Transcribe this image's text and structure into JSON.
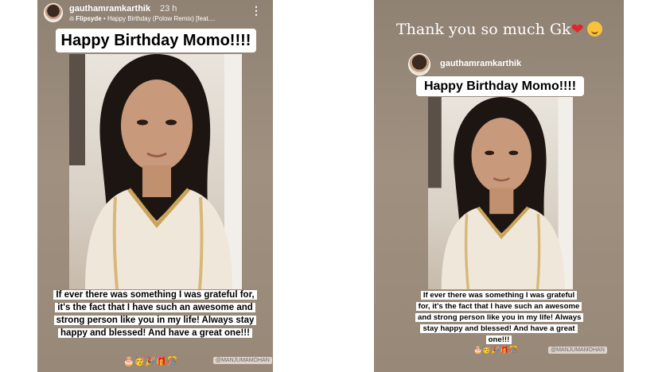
{
  "left_story": {
    "username": "gauthamramkarthik",
    "time_ago": "23 h",
    "music_artist": "Flipsyde",
    "music_separator": " • ",
    "music_title": "Happy Birthday (Polow Remix) [feat....",
    "more_icon": "⋮",
    "title": "Happy Birthday Momo!!!!",
    "message": "If ever there was something I was grateful for, it's the fact that I have such an awesome and strong person like you in my life! Always stay happy and blessed! And have a great one!!!",
    "emojis": "🎂🥳🎉🎁🎊",
    "mention_tag": "@MANJUMAMOHAN"
  },
  "right_story": {
    "caption_text": "Thank you so much Gk",
    "caption_heart": "❤",
    "shared_username": "gauthamramkarthik",
    "title": "Happy Birthday Momo!!!!",
    "message": "If ever there was something I was grateful for, it's the fact that I have such an awesome and strong person like you in my life! Always stay happy and blessed! And have a great one!!!",
    "emojis": "🎂🥳🎉🎁🎊",
    "mention_tag": "@MANJUMAMOHAN"
  },
  "colors": {
    "story_background": "#978877",
    "text_white": "#ffffff",
    "heart_red": "#e3242b",
    "hug_yellow": "#f8c33a"
  },
  "icons": [
    "avatar",
    "music-bars-icon",
    "more-options-icon",
    "heart-emoji",
    "hugging-face-emoji"
  ]
}
